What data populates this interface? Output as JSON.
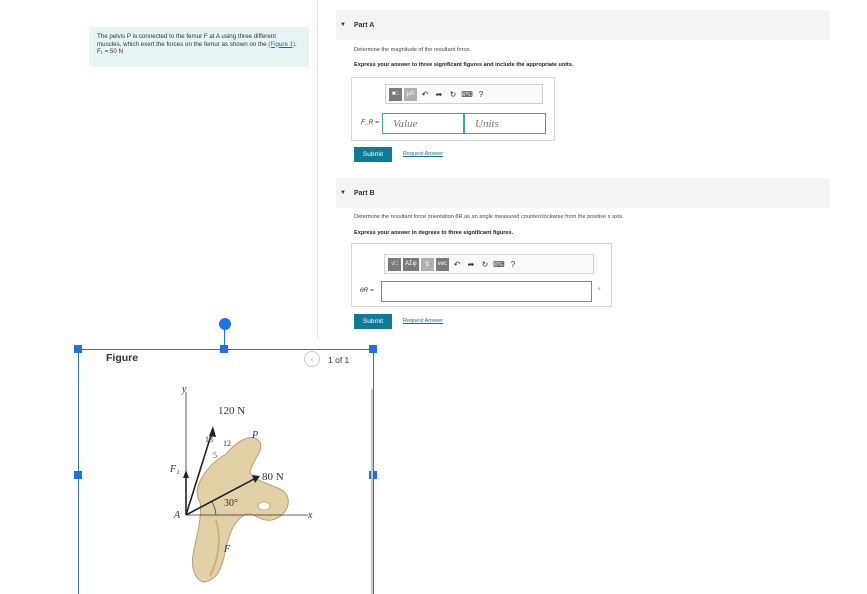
{
  "problem": {
    "text": "The pelvis P is connected to the femur F at A using three different muscles, which exert the forces on the femur as shown on the",
    "figure_link": "(Figure 1)",
    "given": "F₁ = 50 N"
  },
  "part_a": {
    "title": "Part A",
    "instruction": "Determine the magnitude of the resultant force.",
    "emphasis": "Express your answer to three significant figures and include the appropriate units.",
    "field_label": "F_R =",
    "value_placeholder": "Value",
    "units_placeholder": "Units",
    "submit_label": "Submit",
    "request_label": "Request Answer"
  },
  "part_b": {
    "title": "Part B",
    "instruction": "Determine the resultant force orientation θR as an angle measured counterclockwise from the positive x axis.",
    "emphasis": "Express your answer in degrees to three significant figures.",
    "field_label": "θR =",
    "unit_suffix": "°",
    "submit_label": "Submit",
    "request_label": "Request Answer",
    "toolbar_labels": [
      "√□",
      "AΣφ",
      "⇅",
      "vec"
    ]
  },
  "toolbar_a_labels": [
    "■□",
    "μA"
  ],
  "toolbar_icons": [
    "undo-icon",
    "redo-icon",
    "reset-icon",
    "keyboard-icon",
    "help-icon"
  ],
  "help_glyph": "?",
  "figure": {
    "title": "Figure",
    "pager": "1 of 1",
    "labels": {
      "y": "y",
      "x": "x",
      "force_120": "120 N",
      "force_80": "80 N",
      "p": "P",
      "f": "F",
      "a": "A",
      "f1": "F₁",
      "slope_13": "13",
      "slope_12": "12",
      "slope_5": "5",
      "angle": "30°"
    }
  },
  "colors": {
    "accent": "#0d7a99",
    "link": "#1a6ea6",
    "bone": "#e2d0a6",
    "selection": "#1a73e8"
  }
}
